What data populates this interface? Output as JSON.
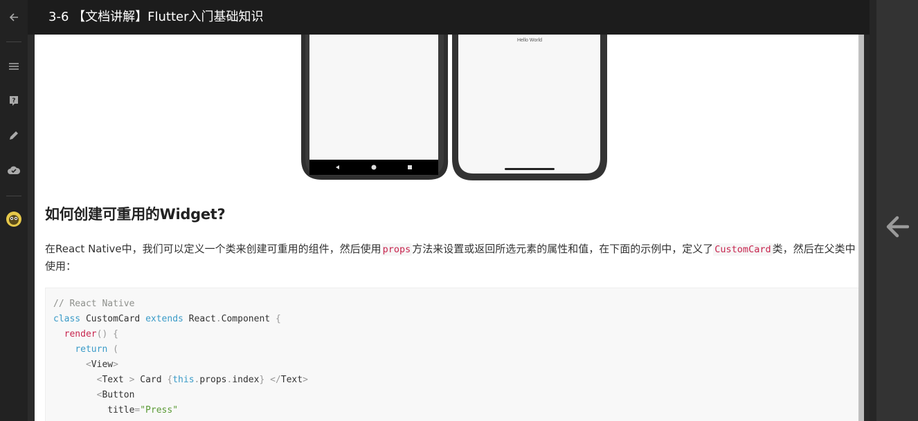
{
  "window": {
    "title": "3-6 【文档讲解】Flutter入门基础知识"
  },
  "sidebar": {
    "items": [
      {
        "name": "back-icon"
      },
      {
        "name": "menu-icon"
      },
      {
        "name": "question-icon"
      },
      {
        "name": "edit-icon"
      },
      {
        "name": "cloud-icon"
      },
      {
        "name": "avatar"
      }
    ]
  },
  "content": {
    "phone_text": "Hello World",
    "heading": "如何创建可重用的Widget?",
    "paragraph": {
      "part1": "在React Native中，我们可以定义一个类来创建可重用的组件，然后使用",
      "code1": "props",
      "part2": "方法来设置或返回所选元素的属性和值，在下面的示例中，定义了",
      "code2": "CustomCard",
      "part3": "类，然后在父类中使用："
    },
    "code_lines": [
      "// React Native",
      "class CustomCard extends React.Component {",
      "  render() {",
      "    return (",
      "      <View>",
      "        <Text > Card {this.props.index} </Text>",
      "        <Button",
      "          title=\"Press\""
    ]
  },
  "colors": {
    "topbar": "#1c1c1c",
    "rail": "#222222",
    "code_bg": "#f8f8f8",
    "inline_code": "#c7254e"
  }
}
